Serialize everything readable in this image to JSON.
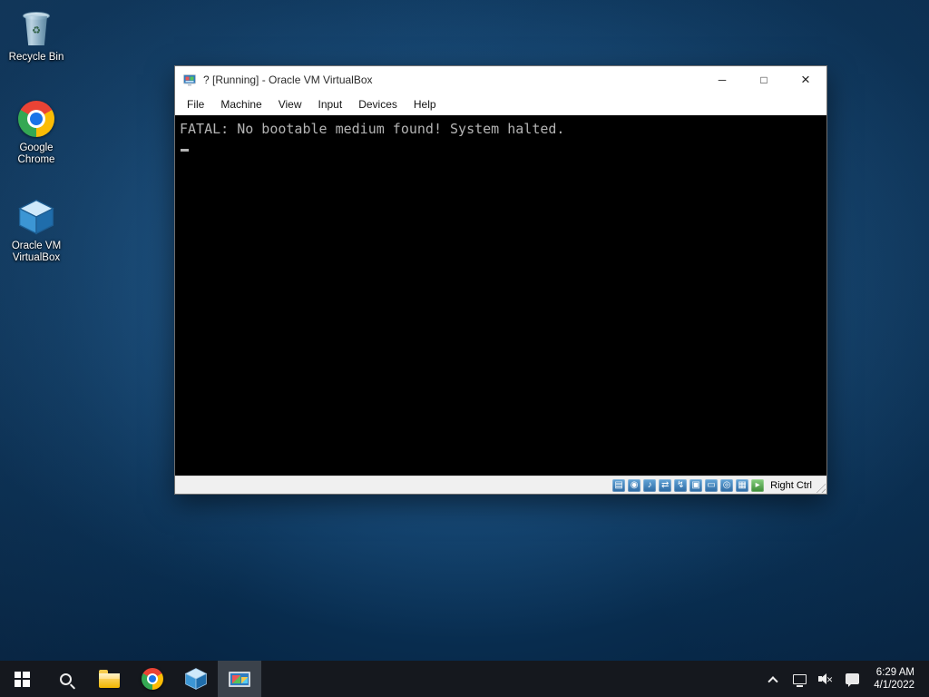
{
  "desktop": {
    "icons": [
      {
        "label": "Recycle Bin"
      },
      {
        "label": "Google Chrome"
      },
      {
        "label": "Oracle VM VirtualBox"
      }
    ]
  },
  "vm_window": {
    "title": "? [Running] - Oracle VM VirtualBox",
    "controls": {
      "minimize": "─",
      "maximize": "□",
      "close": "×"
    },
    "menu": [
      "File",
      "Machine",
      "View",
      "Input",
      "Devices",
      "Help"
    ],
    "console_text": "FATAL: No bootable medium found! System halted.",
    "status": {
      "host_key": "Right Ctrl",
      "icons": [
        {
          "name": "hard-disks",
          "glyph": "▤"
        },
        {
          "name": "optical-drives",
          "glyph": "◉"
        },
        {
          "name": "audio",
          "glyph": "♪"
        },
        {
          "name": "network",
          "glyph": "⇄"
        },
        {
          "name": "usb",
          "glyph": "↯"
        },
        {
          "name": "shared-folders",
          "glyph": "▣"
        },
        {
          "name": "display",
          "glyph": "▭"
        },
        {
          "name": "recording",
          "glyph": "◎"
        },
        {
          "name": "features",
          "glyph": "▦"
        },
        {
          "name": "mouse-integration",
          "glyph": "▸"
        }
      ]
    }
  },
  "taskbar": {
    "clock": {
      "time": "6:29 AM",
      "date": "4/1/2022"
    }
  }
}
